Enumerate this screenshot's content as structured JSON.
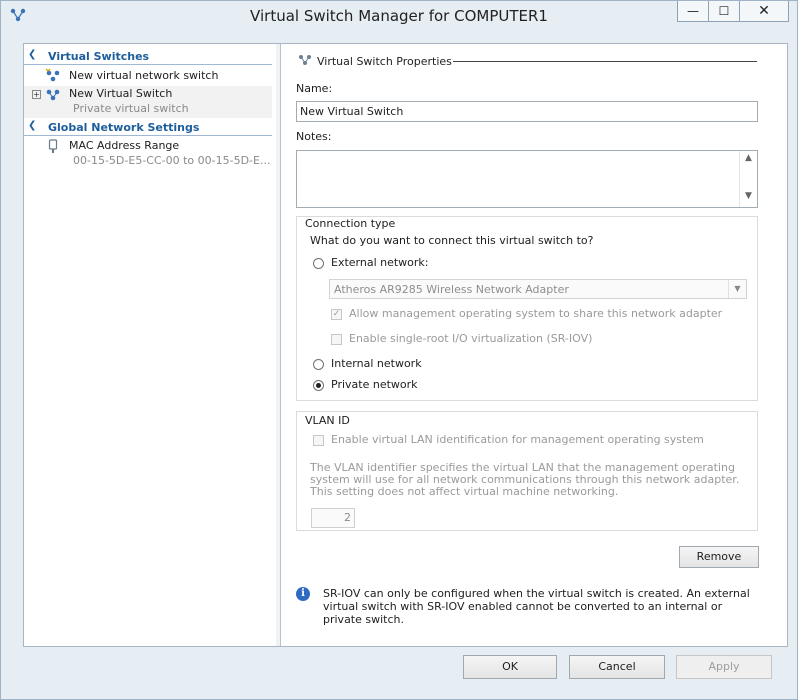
{
  "window": {
    "title": "Virtual Switch Manager for COMPUTER1",
    "min_glyph": "—",
    "max_glyph": "☐",
    "close_glyph": "✕"
  },
  "left_pane": {
    "virtual_switches": {
      "header": "Virtual Switches",
      "items": [
        {
          "label": "New virtual network switch",
          "icon": "new-switch-icon"
        },
        {
          "label": "New Virtual Switch",
          "sublabel": "Private virtual switch",
          "icon": "network-switch-icon"
        }
      ]
    },
    "global_settings": {
      "header": "Global Network Settings",
      "items": [
        {
          "label": "MAC Address Range",
          "sublabel": "00-15-5D-E5-CC-00 to 00-15-5D-E...",
          "icon": "mac-address-icon"
        }
      ]
    }
  },
  "properties": {
    "header": "Virtual Switch Properties",
    "name_label": "Name:",
    "name_value": "New Virtual Switch",
    "notes_label": "Notes:",
    "notes_value": "",
    "connection": {
      "title": "Connection type",
      "question": "What do you want to connect this virtual switch to?",
      "external_label": "External network:",
      "adapter": "Atheros AR9285 Wireless Network Adapter",
      "allow_mgmt_label": "Allow management operating system to share this network adapter",
      "sriov_label": "Enable single-root I/O virtualization (SR-IOV)",
      "internal_label": "Internal network",
      "private_label": "Private network",
      "selected": "Private network"
    },
    "vlan": {
      "title": "VLAN ID",
      "enable_label": "Enable virtual LAN identification for management operating system",
      "description": "The VLAN identifier specifies the virtual LAN that the management operating system will use for all network communications through this network adapter. This setting does not affect virtual machine networking.",
      "value": "2"
    },
    "remove_label": "Remove",
    "info_text": "SR-IOV can only be configured when the virtual switch is created. An external virtual switch with SR-IOV enabled cannot be converted to an internal or private switch."
  },
  "footer": {
    "ok": "OK",
    "cancel": "Cancel",
    "apply": "Apply"
  },
  "colors": {
    "accent": "#1d5e9c",
    "info": "#2f6cc1"
  }
}
